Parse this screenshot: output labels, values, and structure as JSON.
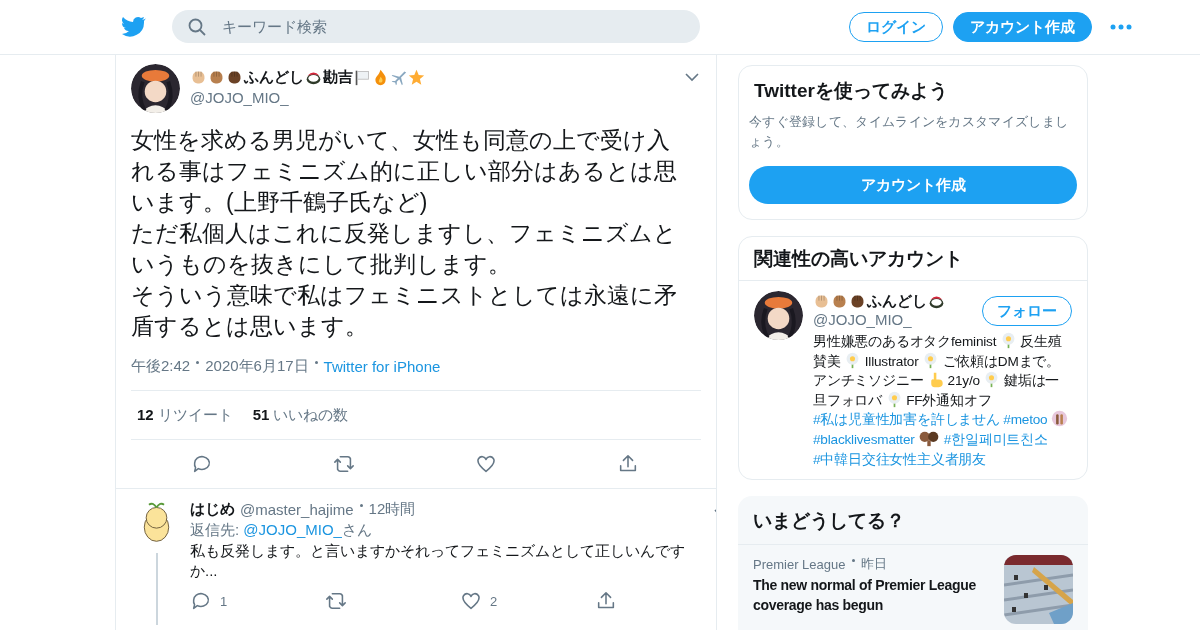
{
  "header": {
    "search": {
      "placeholder": "キーワード検索"
    },
    "login": "ログイン",
    "signup": "アカウント作成"
  },
  "tweet": {
    "author": {
      "name_parts": [
        {
          "kind": "fist",
          "color": "#e8bf94"
        },
        {
          "kind": "fist",
          "color": "#b8804f"
        },
        {
          "kind": "fist",
          "color": "#6b4226"
        },
        {
          "kind": "text",
          "text": "ふんどし"
        },
        {
          "kind": "sushi"
        },
        {
          "kind": "text",
          "text": "勘吉"
        },
        {
          "kind": "flag"
        },
        {
          "kind": "fire"
        },
        {
          "kind": "plane"
        },
        {
          "kind": "star"
        }
      ],
      "handle": "@JOJO_MIO_"
    },
    "paragraphs": [
      "女性を求める男児がいて、女性も同意の上で受け入れる事はフェミニズム的に正しい部分はあるとは思います。(上野千鶴子氏など)",
      "ただ私個人はこれに反発しますし、フェミニズムというものを抜きにして批判します。",
      "そういう意味で私はフェミニストとしては永遠に矛盾するとは思います。"
    ],
    "time": "午後2:42",
    "date": "2020年6月17日",
    "source": "Twitter for iPhone",
    "retweets": {
      "count": "12",
      "label": "リツイート"
    },
    "likes": {
      "count": "51",
      "label": "いいねの数"
    }
  },
  "reply": {
    "name": "はじめ",
    "handle": "@master_hajime",
    "time": "12時間",
    "reply_label": "返信先:",
    "reply_to": "@JOJO_MIO_",
    "reply_suffix": "さん",
    "text": "私も反発します。と言いますかそれってフェミニズムとして正しいんですか...",
    "reply_count": "1",
    "like_count": "2"
  },
  "sidebar": {
    "signup_card": {
      "title": "Twitterを使ってみよう",
      "subtitle": "今すぐ登録して、タイムラインをカスタマイズしましょう。",
      "button": "アカウント作成"
    },
    "related": {
      "title": "関連性の高いアカウント",
      "accounts": [
        {
          "name_parts": [
            {
              "kind": "fist",
              "color": "#e8bf94"
            },
            {
              "kind": "fist",
              "color": "#b8804f"
            },
            {
              "kind": "fist",
              "color": "#6b4226"
            },
            {
              "kind": "text",
              "text": "ふんどし"
            },
            {
              "kind": "sushi"
            }
          ],
          "handle": "@JOJO_MIO_",
          "follow": "フォロー",
          "bio": [
            {
              "kind": "text",
              "text": "男性嫌悪のあるオタクfeminist"
            },
            {
              "kind": "flower"
            },
            {
              "kind": "text",
              "text": "反生殖賛美"
            },
            {
              "kind": "flower"
            },
            {
              "kind": "text",
              "text": "Illustrator"
            },
            {
              "kind": "flower"
            },
            {
              "kind": "text",
              "text": "ご依頼はDMまで。アンチミソジニー"
            },
            {
              "kind": "finger"
            },
            {
              "kind": "text",
              "text": "21y/o"
            },
            {
              "kind": "flower"
            },
            {
              "kind": "text",
              "text": "鍵垢は一旦フォロバ"
            },
            {
              "kind": "flower"
            },
            {
              "kind": "text",
              "text": "FF外通知オフ"
            },
            {
              "kind": "link",
              "text": "#私は児童性加害を許しません"
            },
            {
              "kind": "link",
              "text": "#metoo"
            },
            {
              "kind": "hands"
            },
            {
              "kind": "link",
              "text": "#blacklivesmatter"
            },
            {
              "kind": "fists"
            },
            {
              "kind": "link",
              "text": "#한일페미트친소"
            },
            {
              "kind": "link",
              "text": "#中韓日交往女性主义者朋友"
            }
          ]
        }
      ]
    },
    "trends": {
      "title": "いまどうしてる？",
      "items": [
        {
          "source": "Premier League",
          "time": "昨日",
          "headline": "The new normal of Premier League coverage has begun",
          "kind": "picture"
        }
      ]
    }
  }
}
